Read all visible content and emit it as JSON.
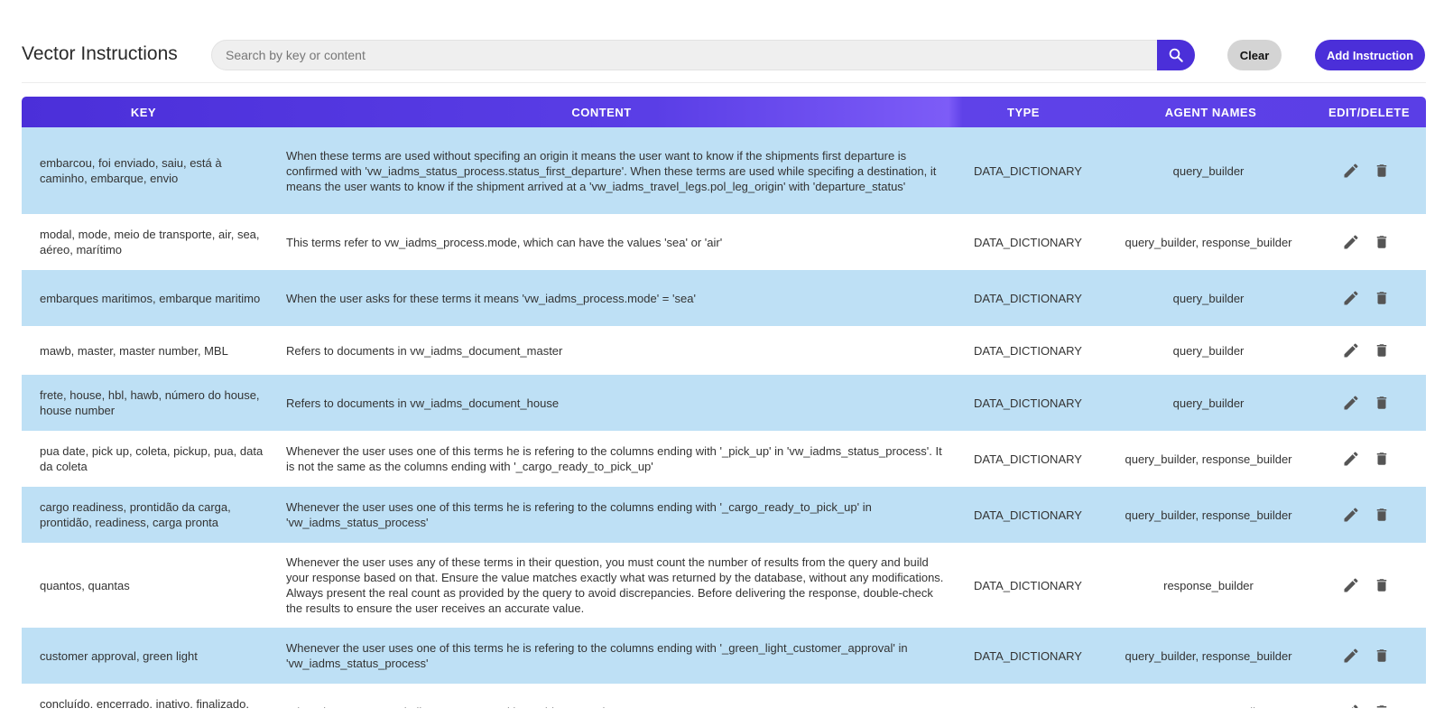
{
  "header": {
    "title": "Vector Instructions",
    "search_placeholder": "Search by key or content",
    "search_value": "",
    "clear_label": "Clear",
    "add_label": "Add Instruction"
  },
  "table": {
    "columns": [
      "KEY",
      "CONTENT",
      "TYPE",
      "AGENT NAMES",
      "EDIT/DELETE"
    ],
    "rows": [
      {
        "key": "embarcou, foi enviado, saiu, está à caminho, embarque, envio",
        "content": "When these terms are used without specifing an origin it means the user want to know if the shipments first departure is confirmed with 'vw_iadms_status_process.status_first_departure'. When these terms are used while specifing a destination, it means the user wants to know if the shipment arrived at a 'vw_iadms_travel_legs.pol_leg_origin' with 'departure_status'",
        "type": "DATA_DICTIONARY",
        "agents": "query_builder"
      },
      {
        "key": "modal, mode, meio de transporte, air, sea, aéreo, marítimo",
        "content": "This terms refer to vw_iadms_process.mode, which can have the values 'sea' or 'air'",
        "type": "DATA_DICTIONARY",
        "agents": "query_builder, response_builder"
      },
      {
        "key": "embarques maritimos, embarque maritimo",
        "content": "When the user asks for these terms it means 'vw_iadms_process.mode' = 'sea'",
        "type": "DATA_DICTIONARY",
        "agents": "query_builder"
      },
      {
        "key": "mawb, master, master number, MBL",
        "content": "Refers to documents in vw_iadms_document_master",
        "type": "DATA_DICTIONARY",
        "agents": "query_builder"
      },
      {
        "key": "frete, house, hbl, hawb, número do house, house number",
        "content": "Refers to documents in vw_iadms_document_house",
        "type": "DATA_DICTIONARY",
        "agents": "query_builder"
      },
      {
        "key": "pua date, pick up, coleta, pickup, pua, data da coleta",
        "content": "Whenever the user uses one of this terms he is refering to the columns ending with '_pick_up' in 'vw_iadms_status_process'. It is not the same as the columns ending with '_cargo_ready_to_pick_up'",
        "type": "DATA_DICTIONARY",
        "agents": "query_builder, response_builder"
      },
      {
        "key": "cargo readiness, prontidão da carga, prontidão, readiness, carga pronta",
        "content": "Whenever the user uses one of this terms he is refering to the columns ending with '_cargo_ready_to_pick_up' in 'vw_iadms_status_process'",
        "type": "DATA_DICTIONARY",
        "agents": "query_builder, response_builder"
      },
      {
        "key": "quantos, quantas",
        "content": "Whenever the user uses any of these terms in their question, you must count the number of results from the query and build your response based on that. Ensure the value matches exactly what was returned by the database, without any modifications. Always present the real count as provided by the query to avoid discrepancies. Before delivering the response, double-check the results to ensure the user receives an accurate value.",
        "type": "DATA_DICTIONARY",
        "agents": "response_builder"
      },
      {
        "key": "customer approval, green light",
        "content": "Whenever the user uses one of this terms he is refering to the columns ending with '_green_light_customer_approval' in 'vw_iadms_status_process'",
        "type": "DATA_DICTIONARY",
        "agents": "query_builder, response_builder"
      },
      {
        "key": "concluído, encerrado, inativo, finalizado, terminado",
        "content": "When these terms or similar ones are used it provides enough context to generate a query",
        "type": "DATA_DICTIONARY",
        "agents": "message_contextualizer"
      }
    ]
  },
  "icons": {
    "search": "search-icon",
    "edit": "pencil-icon",
    "delete": "trash-icon"
  },
  "colors": {
    "accent": "#4b2fd9",
    "row_highlight": "#bee0f5",
    "clear_bg": "#d4d4d4"
  }
}
